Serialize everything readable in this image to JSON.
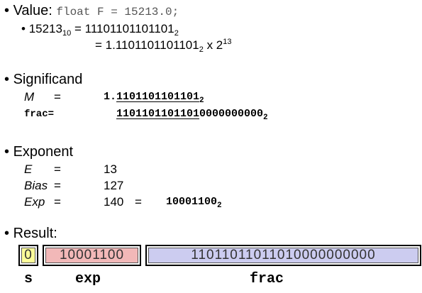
{
  "value": {
    "bullet": "•",
    "label": "Value:",
    "code": "float F = 15213.0;",
    "conv_left_num": "15213",
    "conv_left_base": "10",
    "eq": "=",
    "bin": "11101101101101",
    "bin_base": "2",
    "norm": "1.1101101101101",
    "norm_base": "2",
    "times": "x 2",
    "exponent": "13"
  },
  "significand": {
    "bullet": "•",
    "title": "Significand",
    "m_label": "M",
    "eq": "=",
    "m_int": "1.",
    "m_frac": "1101101101101",
    "m_base": "2",
    "frac_label": "frac=",
    "frac_bits": "1101101101101",
    "frac_zeros": "0000000000",
    "frac_base": "2"
  },
  "exponent": {
    "bullet": "•",
    "title": "Exponent",
    "e_label": "E",
    "e_eq": "=",
    "e_val": "13",
    "bias_label": "Bias",
    "bias_eq": "=",
    "bias_val": "127",
    "exp_label": "Exp",
    "exp_eq": "=",
    "exp_val": "140",
    "exp_eq2": "=",
    "exp_bin": "10001100",
    "exp_base": "2"
  },
  "result": {
    "bullet": "•",
    "title": "Result:",
    "s_bits": "0",
    "exp_bits": "10001100",
    "frac_bits": "11011011011010000000000",
    "s_label": "s",
    "exp_label": "exp",
    "frac_label": "frac",
    "colors": {
      "s": "#ffff99",
      "exp": "#f2b8b8",
      "frac": "#ccccf0"
    }
  }
}
